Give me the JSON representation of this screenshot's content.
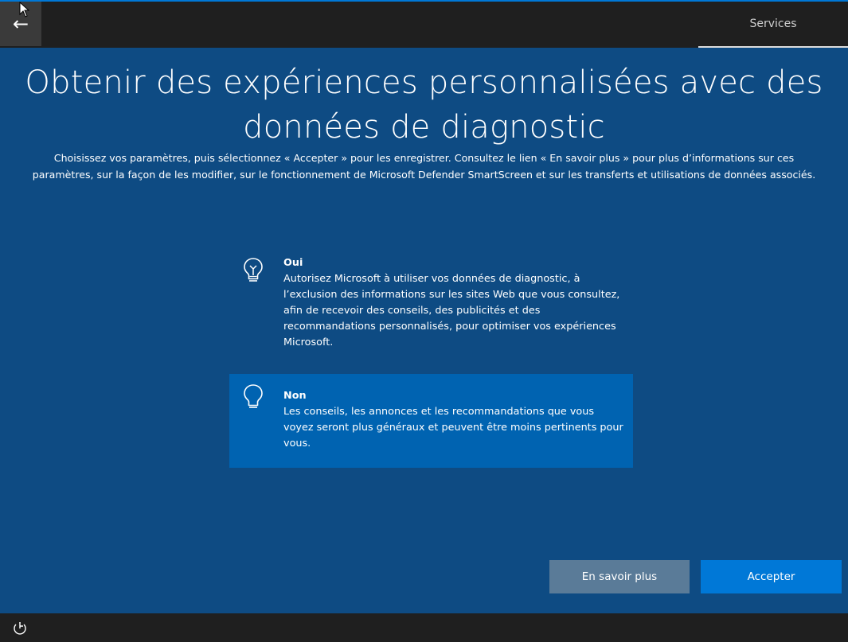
{
  "topbar": {
    "back_glyph": "←",
    "back_icon": "back-arrow-icon",
    "tab_label": "Services"
  },
  "main": {
    "title": "Obtenir des expériences personnalisées avec des données de diagnostic",
    "subtitle": "Choisissez vos paramètres, puis sélectionnez « Accepter » pour les enregistrer. Consultez le lien « En savoir plus » pour plus d’informations sur ces paramètres, sur la façon de les modifier, sur le fonctionnement de Microsoft Defender SmartScreen et sur les transferts et utilisations de données associés.",
    "options": [
      {
        "title": "Oui",
        "description": "Autorisez Microsoft à utiliser vos données de diagnostic, à l’exclusion des informations sur les sites Web que vous consultez, afin de recevoir des conseils, des publicités et des recommandations personnalisés, pour optimiser vos expériences Microsoft.",
        "icon": "lightbulb-on-icon",
        "selected": false
      },
      {
        "title": "Non",
        "description": "Les conseils, les annonces et les recommandations que vous voyez seront plus généraux et peuvent être moins pertinents pour vous.",
        "icon": "lightbulb-off-icon",
        "selected": true
      }
    ],
    "learn_more_label": "En savoir plus",
    "accept_label": "Accepter"
  },
  "bottombar": {
    "icon": "accessibility-icon"
  },
  "colors": {
    "background": "#0e4b83",
    "selected_option": "#0063b1",
    "accent": "#0078d7",
    "secondary_button": "#5a7b98",
    "bar": "#1f1f1f"
  }
}
